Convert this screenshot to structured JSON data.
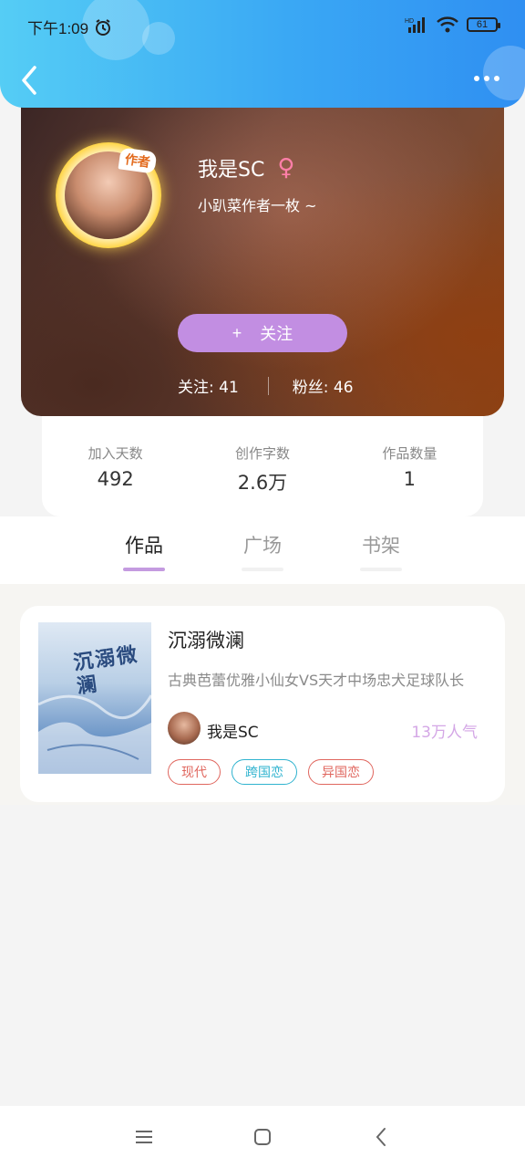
{
  "status_bar": {
    "time": "下午1:09",
    "battery": "61"
  },
  "profile": {
    "author_badge": "作者",
    "name": "我是SC",
    "gender_symbol": "♀",
    "bio": "小趴菜作者一枚 ~",
    "follow_button": {
      "plus": "+",
      "label": "关注"
    },
    "following": "关注: 41",
    "fans": "粉丝: 46"
  },
  "stats": [
    {
      "label": "加入天数",
      "value": "492"
    },
    {
      "label": "创作字数",
      "value": "2.6万"
    },
    {
      "label": "作品数量",
      "value": "1"
    }
  ],
  "tabs": [
    {
      "label": "作品",
      "active": true
    },
    {
      "label": "广场",
      "active": false
    },
    {
      "label": "书架",
      "active": false
    }
  ],
  "book": {
    "cover_title": "沉溺微澜",
    "title": "沉溺微澜",
    "description": "古典芭蕾优雅小仙女VS天才中场忠犬足球队长",
    "author": "我是SC",
    "popularity": "13万人气",
    "tags": [
      {
        "label": "现代",
        "color": "#e0665e"
      },
      {
        "label": "跨国恋",
        "color": "#2fb3cf"
      },
      {
        "label": "异国恋",
        "color": "#e0665e"
      }
    ]
  },
  "colors": {
    "header": "#3aa8f4",
    "follow_button": "#c28ee2",
    "tab_indicator": "#c49be0",
    "popularity": "#d4a7e6"
  }
}
